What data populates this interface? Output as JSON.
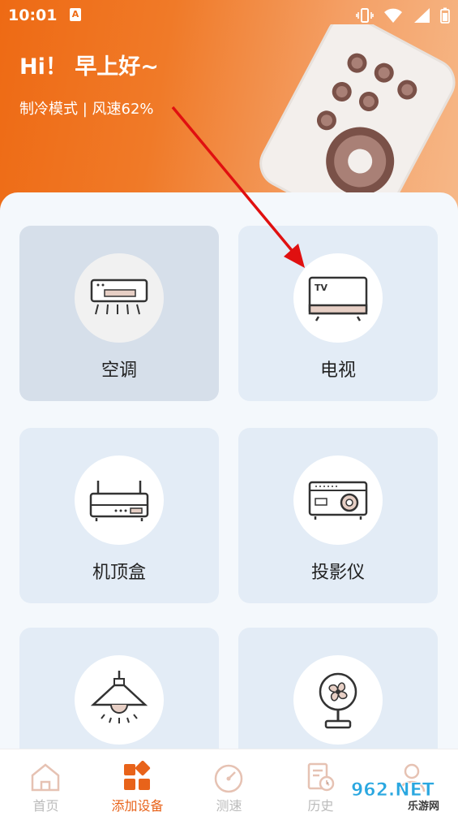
{
  "status_bar": {
    "time": "10:01",
    "notif_icon": "A"
  },
  "header": {
    "greeting": "Hi！ 早上好~",
    "mode_text": "制冷模式 | 风速62%"
  },
  "devices": [
    {
      "label": "空调",
      "icon": "air-conditioner-icon",
      "selected": true
    },
    {
      "label": "电视",
      "icon": "tv-icon",
      "selected": false
    },
    {
      "label": "机顶盒",
      "icon": "set-top-box-icon",
      "selected": false
    },
    {
      "label": "投影仪",
      "icon": "projector-icon",
      "selected": false
    },
    {
      "label": "",
      "icon": "lamp-icon",
      "selected": false
    },
    {
      "label": "",
      "icon": "fan-icon",
      "selected": false
    }
  ],
  "tabs": [
    {
      "label": "首页",
      "icon": "home-icon",
      "active": false
    },
    {
      "label": "添加设备",
      "icon": "add-device-icon",
      "active": true
    },
    {
      "label": "测速",
      "icon": "speedometer-icon",
      "active": false
    },
    {
      "label": "历史",
      "icon": "history-icon",
      "active": false
    },
    {
      "label": "",
      "icon": "profile-icon",
      "active": false
    }
  ],
  "watermark": {
    "text": "962.NET",
    "subtext": "乐游网"
  },
  "colors": {
    "accent": "#e8631a",
    "header_start": "#ee6a14",
    "card_bg": "#e3ecf6",
    "arrow": "#e01010"
  }
}
